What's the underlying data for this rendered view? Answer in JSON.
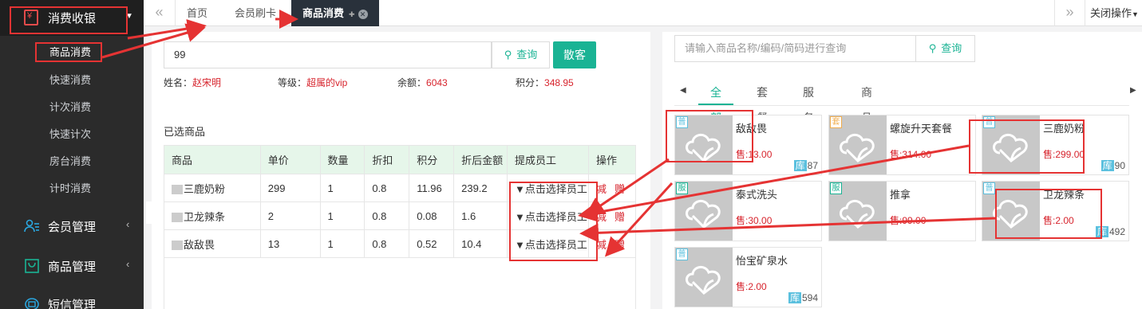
{
  "sidebar": {
    "title": "消费收银",
    "sub_items": [
      "商品消费",
      "快速消费",
      "计次消费",
      "快速计次",
      "房台消费",
      "计时消费"
    ],
    "menus": [
      {
        "label": "会员管理",
        "icon": "user-group-icon"
      },
      {
        "label": "商品管理",
        "icon": "shopping-bag-icon"
      },
      {
        "label": "短信管理",
        "icon": "message-icon"
      }
    ]
  },
  "tabs": {
    "items": [
      "首页",
      "会员刷卡",
      "商品消费"
    ],
    "close_op": "关闭操作"
  },
  "member_search": {
    "value": "99",
    "query_label": "查询",
    "guest_label": "散客"
  },
  "member_info": {
    "name_label": "姓名：",
    "name": "赵宋明",
    "level_label": "等级：",
    "level": "超属的vip",
    "balance_label": "余额：",
    "balance": "6043",
    "points_label": "积分：",
    "points": "348.95"
  },
  "selected": {
    "title": "已选商品",
    "headers": [
      "商品",
      "单价",
      "数量",
      "折扣",
      "积分",
      "折后金额",
      "提成员工",
      "操作"
    ],
    "rows": [
      {
        "name": "三鹿奶粉",
        "price": "299",
        "qty": "1",
        "discount": "0.8",
        "points": "11.96",
        "amount": "239.2",
        "employee": "点击选择员工"
      },
      {
        "name": "卫龙辣条",
        "price": "2",
        "qty": "1",
        "discount": "0.8",
        "points": "0.08",
        "amount": "1.6",
        "employee": "点击选择员工"
      },
      {
        "name": "敌敌畏",
        "price": "13",
        "qty": "1",
        "discount": "0.8",
        "points": "0.52",
        "amount": "10.4",
        "employee": "点击选择员工"
      }
    ],
    "op_reduce": "减",
    "op_gift": "赠"
  },
  "product_search": {
    "placeholder": "请输入商品名称/编码/简码进行查询",
    "query_label": "查询"
  },
  "categories": [
    "全部",
    "套餐",
    "服务类",
    "商品"
  ],
  "products": [
    {
      "badge": "普",
      "badge_color": "#5bc0de",
      "name": "敌敌畏",
      "price": "售:13.00",
      "stock_label": "库",
      "stock": "87"
    },
    {
      "badge": "套",
      "badge_color": "#f0ad4e",
      "name": "螺旋升天套餐",
      "price": "售:314.00",
      "stock_label": "",
      "stock": ""
    },
    {
      "badge": "普",
      "badge_color": "#5bc0de",
      "name": "三鹿奶粉",
      "price": "售:299.00",
      "stock_label": "库",
      "stock": "90"
    },
    {
      "badge": "服",
      "badge_color": "#1ab394",
      "name": "泰式洗头",
      "price": "售:30.00",
      "stock_label": "",
      "stock": ""
    },
    {
      "badge": "服",
      "badge_color": "#1ab394",
      "name": "推拿",
      "price": "售:99.00",
      "stock_label": "",
      "stock": ""
    },
    {
      "badge": "普",
      "badge_color": "#5bc0de",
      "name": "卫龙辣条",
      "price": "售:2.00",
      "stock_label": "库",
      "stock": "492"
    },
    {
      "badge": "普",
      "badge_color": "#5bc0de",
      "name": "怡宝矿泉水",
      "price": "售:2.00",
      "stock_label": "库",
      "stock": "594"
    }
  ],
  "colors": {
    "accent": "#1ab394",
    "price_red": "#d7242d",
    "annotation_red": "#e53333",
    "sidebar": "#2b2b2b"
  }
}
